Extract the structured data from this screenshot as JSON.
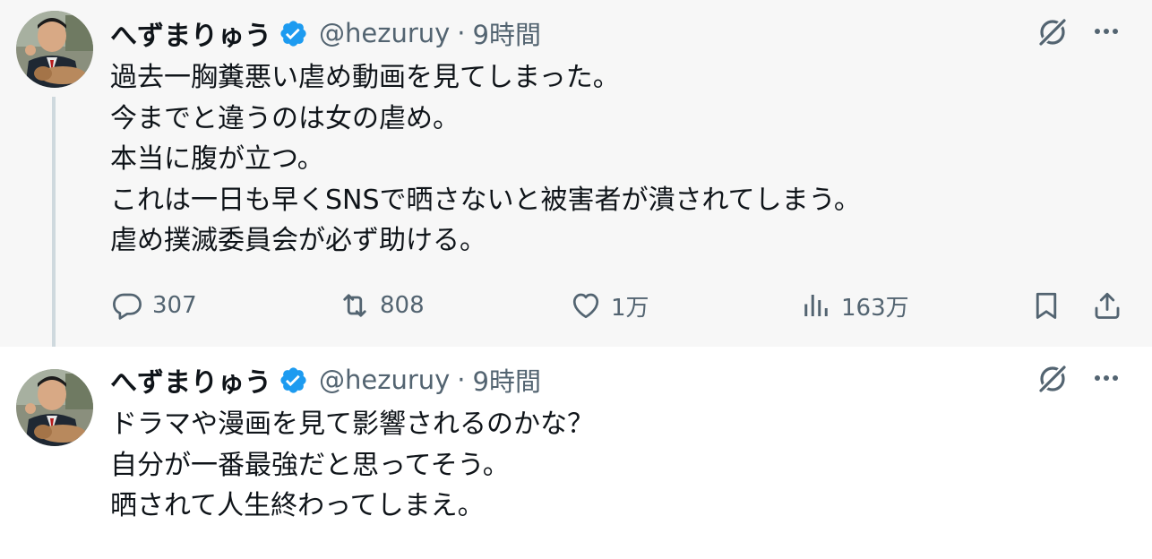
{
  "tweets": [
    {
      "author": {
        "name": "へずまりゅう",
        "handle": "@hezuruy",
        "separator": "·",
        "time": "9時間",
        "verified": true,
        "badge_color": "#1d9bf0"
      },
      "text_lines": [
        "過去一胸糞悪い虐め動画を見てしまった。",
        "今までと違うのは女の虐め。",
        "本当に腹が立つ。",
        "これは一日も早くSNSで晒さないと被害者が潰されてしまう。",
        "虐め撲滅委員会が必ず助ける。"
      ],
      "actions": {
        "replies": "307",
        "reposts": "808",
        "likes": "1万",
        "views": "163万"
      }
    },
    {
      "author": {
        "name": "へずまりゅう",
        "handle": "@hezuruy",
        "separator": "·",
        "time": "9時間",
        "verified": true,
        "badge_color": "#1d9bf0"
      },
      "text_lines": [
        "ドラマや漫画を見て影響されるのかな？",
        "自分が一番最強だと思ってそう。",
        "晒されて人生終わってしまえ。"
      ]
    }
  ],
  "colors": {
    "text": "#0f1419",
    "muted": "#536471",
    "highlight_bg": "#f7f7f7",
    "thread_line": "#cfd9de",
    "verified": "#1d9bf0"
  },
  "icons": [
    "grok-icon",
    "more-icon",
    "reply-icon",
    "repost-icon",
    "like-icon",
    "views-icon",
    "bookmark-icon",
    "share-icon",
    "verified-badge-icon"
  ]
}
